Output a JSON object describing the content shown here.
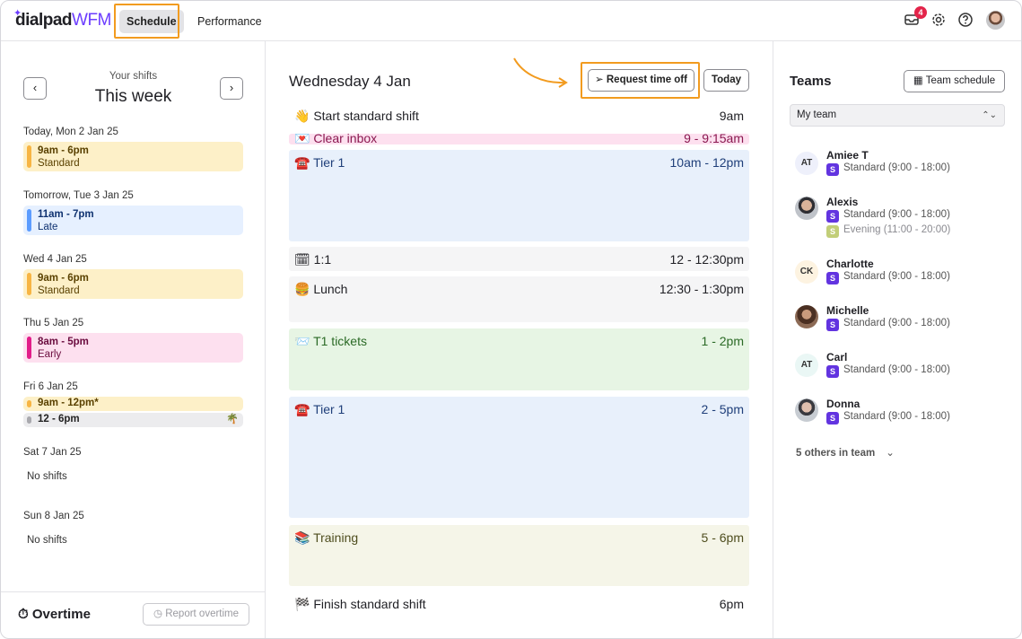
{
  "brand": {
    "name": "dialpad",
    "product": "WFM",
    "purple": "#6c3dff",
    "orange_highlight": "#f29b1f"
  },
  "nav": {
    "tabs": [
      {
        "label": "Schedule"
      },
      {
        "label": "Performance"
      }
    ]
  },
  "topbar": {
    "inbox_badge": "4",
    "icons": [
      "inbox-icon",
      "gear-icon",
      "help-icon",
      "avatar"
    ]
  },
  "left": {
    "prev": "‹",
    "next": "›",
    "subtitle": "Your shifts",
    "title": "This week",
    "days": [
      {
        "label": "Today, Mon 2 Jan 25",
        "shifts": [
          {
            "time": "9am - 6pm",
            "type": "Standard",
            "color": "#f7b544",
            "bg": "#fdf0c8"
          }
        ]
      },
      {
        "label": "Tomorrow, Tue 3 Jan 25",
        "shifts": [
          {
            "time": "11am - 7pm",
            "type": "Late",
            "color": "#5b9cff",
            "bg": "#e6f0ff"
          }
        ]
      },
      {
        "label": "Wed 4 Jan 25",
        "shifts": [
          {
            "time": "9am - 6pm",
            "type": "Standard",
            "color": "#f7b544",
            "bg": "#fdf0c8"
          }
        ]
      },
      {
        "label": "Thu 5 Jan 25",
        "shifts": [
          {
            "time": "8am - 5pm",
            "type": "Early",
            "color": "#e21d8a",
            "bg": "#fde0ef"
          }
        ]
      },
      {
        "label": "Fri 6 Jan 25",
        "shifts": [
          {
            "time": "9am - 12pm*",
            "color": "#f7b544",
            "bg": "#fdf0c8"
          },
          {
            "time": "12 - 6pm",
            "color": "#a9a9ae",
            "bg": "#ececee",
            "icon": "🌴"
          }
        ]
      },
      {
        "label": "Sat 7 Jan 25",
        "empty": "No shifts"
      },
      {
        "label": "Sun 8 Jan 25",
        "empty": "No shifts"
      }
    ],
    "overtime": {
      "title": "Overtime",
      "button": "Report overtime",
      "timer_icon": "⏱"
    }
  },
  "middle": {
    "date": "Wednesday 4 Jan",
    "request_button": "Request time off",
    "today_button": "Today",
    "events": [
      {
        "emoji": "👋",
        "name": "Start standard shift",
        "time": "9am"
      },
      {
        "emoji": "💌",
        "name": "Clear inbox",
        "time": "9 - 9:15am",
        "bg": "#fde0ef",
        "fg": "#8a1850"
      },
      {
        "emoji": "☎️",
        "name": "Tier 1",
        "time": "10am - 12pm",
        "bg": "#e8f0fb",
        "fg": "#1f3f7a"
      },
      {
        "emoji": "🗓",
        "name": "1:1",
        "time": "12 - 12:30pm",
        "bg": "#f5f5f6",
        "fg": "#1f1f24"
      },
      {
        "emoji": "🍔",
        "name": "Lunch",
        "time": "12:30 - 1:30pm",
        "bg": "#f5f5f6",
        "fg": "#1f1f24"
      },
      {
        "emoji": "📨",
        "name": "T1 tickets",
        "time": "1 - 2pm",
        "bg": "#e7f5e4",
        "fg": "#2b6a26"
      },
      {
        "emoji": "☎️",
        "name": "Tier 1",
        "time": "2 - 5pm",
        "bg": "#e8f0fb",
        "fg": "#1f3f7a"
      },
      {
        "emoji": "📚",
        "name": "Training",
        "time": "5 - 6pm",
        "bg": "#f5f5e8",
        "fg": "#4e4d1e"
      },
      {
        "emoji": "🏁",
        "name": "Finish standard shift",
        "time": "6pm"
      }
    ]
  },
  "right": {
    "title": "Teams",
    "team_schedule_button": "Team schedule",
    "team_select": "My team",
    "members": [
      {
        "name": "Amiee T",
        "initials": "AT",
        "shifts": [
          {
            "badge": "S",
            "label": "Standard (9:00 - 18:00)",
            "color": "#6234e0"
          }
        ]
      },
      {
        "name": "Alexis",
        "initials": "",
        "shifts": [
          {
            "badge": "S",
            "label": "Standard (9:00 - 18:00)",
            "color": "#6234e0"
          },
          {
            "badge": "S",
            "label": "Evening (11:00 - 20:00)",
            "color": "#c2ce78",
            "muted": true
          }
        ]
      },
      {
        "name": "Charlotte",
        "initials": "CK",
        "shifts": [
          {
            "badge": "S",
            "label": "Standard (9:00 - 18:00)",
            "color": "#6234e0"
          }
        ]
      },
      {
        "name": "Michelle",
        "initials": "",
        "shifts": [
          {
            "badge": "S",
            "label": "Standard (9:00 - 18:00)",
            "color": "#6234e0"
          }
        ]
      },
      {
        "name": "Carl",
        "initials": "AT",
        "shifts": [
          {
            "badge": "S",
            "label": "Standard (9:00 - 18:00)",
            "color": "#6234e0"
          }
        ]
      },
      {
        "name": "Donna",
        "initials": "",
        "shifts": [
          {
            "badge": "S",
            "label": "Standard (9:00 - 18:00)",
            "color": "#6234e0"
          }
        ]
      }
    ],
    "others": "5 others in team"
  }
}
